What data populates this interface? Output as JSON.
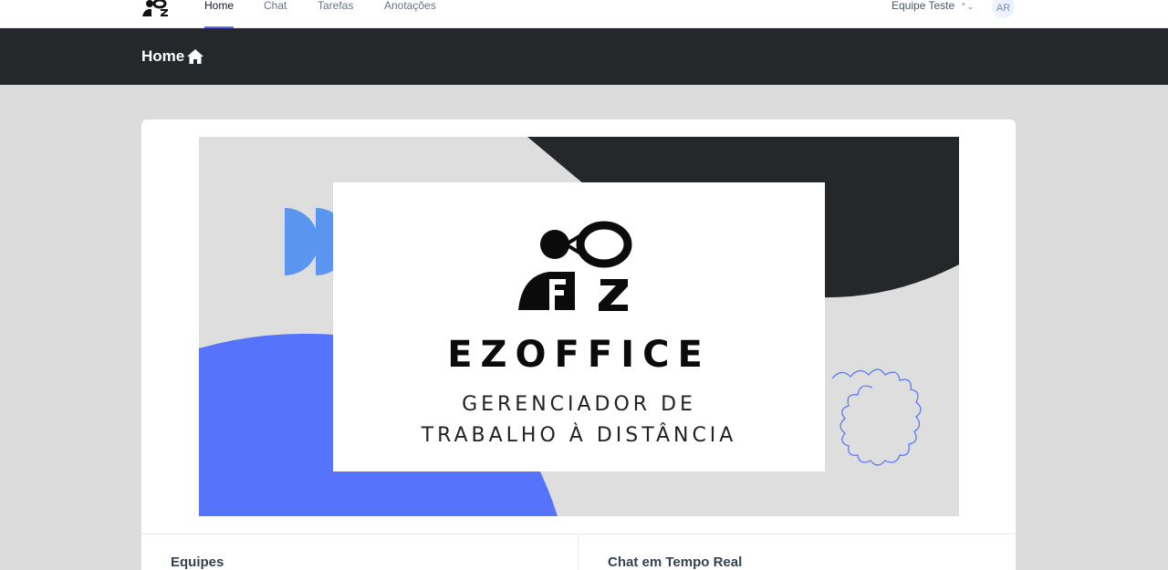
{
  "nav": {
    "links": [
      {
        "label": "Home",
        "active": true
      },
      {
        "label": "Chat",
        "active": false
      },
      {
        "label": "Tarefas",
        "active": false
      },
      {
        "label": "Anotações",
        "active": false
      }
    ],
    "team_label": "Equipe Teste",
    "avatar_initials": "AR"
  },
  "header": {
    "title": "Home",
    "icon": "home-icon"
  },
  "banner": {
    "brand": "EZOFFICE",
    "subtitle_line1": "GERENCIADOR DE",
    "subtitle_line2": "TRABALHO À DISTÂNCIA",
    "colors": {
      "dark": "#25282b",
      "blue": "#5573fb",
      "light_blue": "#5a96f0",
      "gray": "#dedede"
    }
  },
  "sections": {
    "left_title": "Equipes",
    "right_title": "Chat em Tempo Real"
  },
  "colors": {
    "header_bg": "#25282b",
    "page_bg": "#dcdcdc",
    "accent": "#6366f1"
  }
}
